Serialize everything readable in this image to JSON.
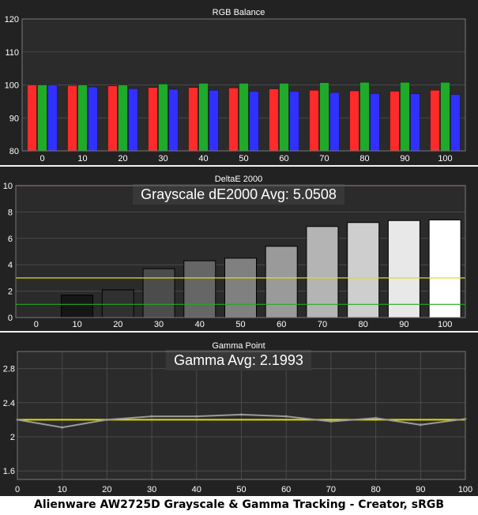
{
  "caption": "Alienware AW2725D Grayscale & Gamma Tracking - Creator, sRGB",
  "colors": {
    "background": "#222222",
    "panel": "#2b2b2b",
    "separator": "#f2f2f2",
    "grid": "#4a4a4a",
    "text": "#ffffff",
    "red": "#ff2a2a",
    "green": "#1faa2a",
    "blue": "#3030ff",
    "reference_line": "#e0e000",
    "de_red_line": "#ff3333",
    "de_yellow_line": "#dddd22",
    "de_green_line": "#22aa22",
    "gamma_line": "#9a9a9a"
  },
  "chart_data": [
    {
      "type": "bar",
      "title": "RGB Balance",
      "categories": [
        "0",
        "10",
        "20",
        "30",
        "40",
        "50",
        "60",
        "70",
        "80",
        "90",
        "100"
      ],
      "ylim": [
        80,
        120
      ],
      "yticks": [
        80,
        90,
        100,
        110,
        120
      ],
      "grid": true,
      "series": [
        {
          "color": "#ff2a2a",
          "values": [
            100.0,
            99.8,
            99.7,
            99.2,
            99.2,
            99.1,
            98.8,
            98.4,
            98.2,
            98.1,
            98.4
          ]
        },
        {
          "color": "#1faa2a",
          "values": [
            100.0,
            100.0,
            100.0,
            100.3,
            100.5,
            100.5,
            100.5,
            100.7,
            100.8,
            100.8,
            100.8
          ]
        },
        {
          "color": "#3030ff",
          "values": [
            100.0,
            99.4,
            98.9,
            98.7,
            98.4,
            98.1,
            98.1,
            97.7,
            97.4,
            97.3,
            97.1
          ]
        }
      ]
    },
    {
      "type": "bar",
      "title": "DeltaE 2000",
      "annotation": "Grayscale dE2000 Avg: 5.0508",
      "categories": [
        "0",
        "10",
        "20",
        "30",
        "40",
        "50",
        "60",
        "70",
        "80",
        "90",
        "100"
      ],
      "values": [
        0,
        1.7,
        2.1,
        3.7,
        4.3,
        4.5,
        5.4,
        6.9,
        7.2,
        7.35,
        7.4
      ],
      "bar_grays": [
        "#000000",
        "#161616",
        "#303030",
        "#4c4c4c",
        "#666666",
        "#808080",
        "#9a9a9a",
        "#b4b4b4",
        "#cecece",
        "#e8e8e8",
        "#ffffff"
      ],
      "ylim": [
        0,
        10
      ],
      "yticks": [
        0,
        2,
        4,
        6,
        8,
        10
      ],
      "reference_lines": [
        10,
        3,
        1
      ],
      "grid": true
    },
    {
      "type": "line",
      "title": "Gamma Point",
      "annotation": "Gamma Avg: 2.1993",
      "x": [
        0,
        10,
        20,
        30,
        40,
        50,
        60,
        70,
        80,
        90,
        100
      ],
      "y": [
        2.2,
        2.11,
        2.2,
        2.24,
        2.24,
        2.26,
        2.24,
        2.18,
        2.22,
        2.14,
        2.21
      ],
      "reference_y": 2.2,
      "xlim": [
        0,
        100
      ],
      "xticks": [
        0,
        10,
        20,
        30,
        40,
        50,
        60,
        70,
        80,
        90,
        100
      ],
      "ylim": [
        1.5,
        3.0
      ],
      "yticks": [
        1.6,
        2,
        2.4,
        2.8
      ],
      "ytick_labels": [
        "1.6",
        "2",
        "2.4",
        "2.8"
      ],
      "grid": true
    }
  ]
}
